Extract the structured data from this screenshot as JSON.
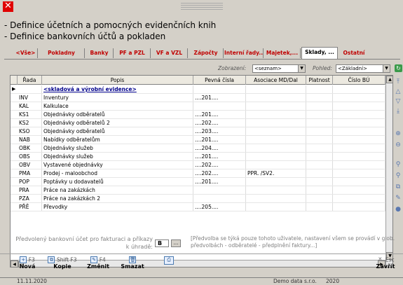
{
  "window": {
    "title_line1": "- Definice účetních a pomocných evidenčních knih",
    "title_line2": "- Definice bankovních účtů a pokladen",
    "close_glyph": "✕"
  },
  "tabs": [
    {
      "label": "<Vše>"
    },
    {
      "label": "Pokladny"
    },
    {
      "label": "Banky"
    },
    {
      "label": "PF a PZL"
    },
    {
      "label": "VF a VZL"
    },
    {
      "label": "Zápočty"
    },
    {
      "label": "Interní řady.."
    },
    {
      "label": "Majetek,..."
    },
    {
      "label": "Sklady, ..."
    },
    {
      "label": "Ostatní"
    }
  ],
  "filters": {
    "zobrazeni_label": "Zobrazení:",
    "zobrazeni_value": "<seznam>",
    "pohled_label": "Pohled:",
    "pohled_value": "<Základní>"
  },
  "grid": {
    "columns": [
      "Řada",
      "Popis",
      "Pevná čísla",
      "Asociace MD/Dal",
      "Platnost",
      "Číslo BÚ"
    ],
    "rows": [
      {
        "rada": "",
        "popis": "<skladová a výrobní evidence>",
        "pevna": "",
        "asociace": "",
        "group": true
      },
      {
        "rada": "INV",
        "popis": "Inventury",
        "pevna": "....201....",
        "asociace": ""
      },
      {
        "rada": "KAL",
        "popis": "Kalkulace",
        "pevna": "",
        "asociace": ""
      },
      {
        "rada": "KS1",
        "popis": "Objednávky odběratelů",
        "pevna": "....201....",
        "asociace": ""
      },
      {
        "rada": "KS2",
        "popis": "Objednávky odběratelů 2",
        "pevna": "....202....",
        "asociace": ""
      },
      {
        "rada": "KSO",
        "popis": "Objednávky odběratelů",
        "pevna": "....203....",
        "asociace": ""
      },
      {
        "rada": "NAB",
        "popis": "Nabídky odběratelům",
        "pevna": "....201....",
        "asociace": ""
      },
      {
        "rada": "OBK",
        "popis": "Objednávky služeb",
        "pevna": "....204....",
        "asociace": ""
      },
      {
        "rada": "OBS",
        "popis": "Objednávky služeb",
        "pevna": "....201....",
        "asociace": ""
      },
      {
        "rada": "OBV",
        "popis": "Vystavené objednávky",
        "pevna": "....202....",
        "asociace": ""
      },
      {
        "rada": "PMA",
        "popis": "Prodej - maloobchod",
        "pevna": "....202....",
        "asociace": "PPR.    /SV2."
      },
      {
        "rada": "POP",
        "popis": "Poptávky u dodavatelů",
        "pevna": "....201....",
        "asociace": ""
      },
      {
        "rada": "PRA",
        "popis": "Práce na zakázkách",
        "pevna": "",
        "asociace": ""
      },
      {
        "rada": "PZA",
        "popis": "Práce na zakázkách 2",
        "pevna": "",
        "asociace": ""
      },
      {
        "rada": "PŘĚ",
        "popis": "Převodky",
        "pevna": "....205....",
        "asociace": ""
      }
    ]
  },
  "bank": {
    "label": "Předvolený bankovní účet pro fakturaci a příkazy k úhradě:",
    "value": "B",
    "button": "...",
    "note": "[Předvolba se týká pouze tohoto uživatele, nastavení všem se provádí v glob. předvolbách - odběratelé - předplnění faktury...]"
  },
  "toolbar": {
    "new_key": "F3",
    "new_label": "Nová",
    "copy_key": "Shift F3",
    "copy_label": "Kopie",
    "edit_key": "F4",
    "edit_label": "Změnit",
    "delete_label": "Smazat",
    "close_key": "Esc",
    "close_label": "Zavřít"
  },
  "status": {
    "date": "11.11.2020",
    "company": "Demo data s.r.o.",
    "year": "2020"
  },
  "colors": {
    "tab_text": "#c00000",
    "group_text": "#00008b",
    "close_bg": "#e00000"
  }
}
